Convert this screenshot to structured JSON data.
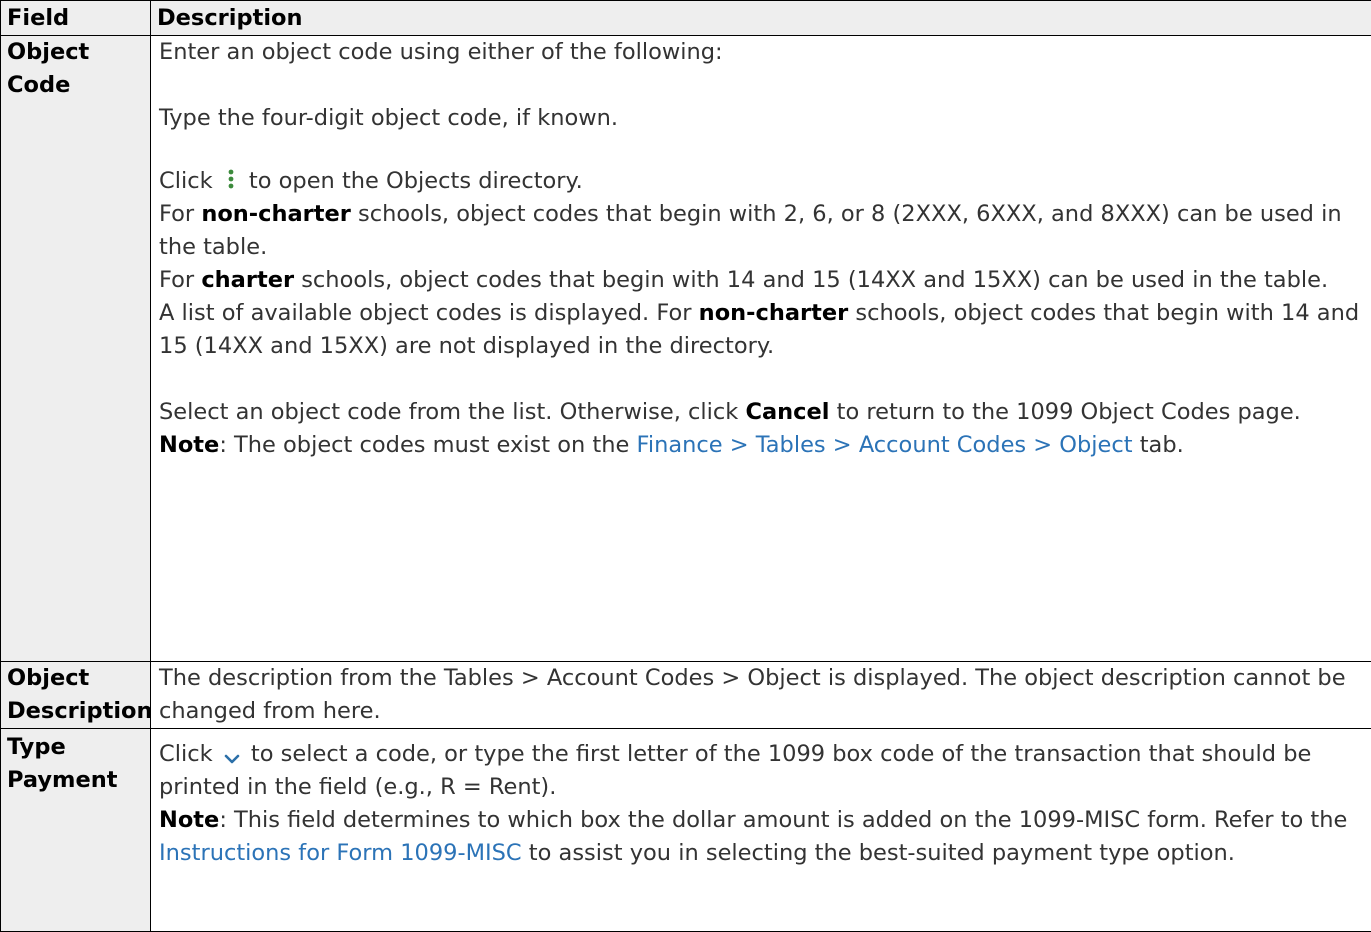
{
  "header": {
    "field": "Field",
    "description": "Description"
  },
  "icons": {
    "directory_icon": "vertical-ellipsis-icon",
    "dropdown_icon": "chevron-down-icon",
    "dots_color": "#3c8a3c",
    "chevron_color": "#2b6fa8",
    "link_color": "#2b73b7"
  },
  "rows": {
    "object_code": {
      "name": "Object Code",
      "p1": "Enter an object code using either of the following:",
      "p2": "Type the four-digit object code, if known.",
      "p3a": "Click ",
      "p3b": " to open the Objects directory.",
      "p4a": "For ",
      "p4b": "non-charter",
      "p4c": " schools, object codes that begin with 2, 6, or 8 (2XXX, 6XXX, and 8XXX) can be used in the table.",
      "p5a": "For ",
      "p5b": "charter",
      "p5c": " schools, object codes that begin with 14 and 15 (14XX and 15XX) can be used in the table.",
      "p6a": "A list of available object codes is displayed. For ",
      "p6b": "non-charter",
      "p6c": " schools, object codes that begin with 14 and 15 (14XX and 15XX) are not displayed in the directory.",
      "p7a": "Select an object code from the list. Otherwise, click ",
      "p7b": "Cancel",
      "p7c": " to return to the 1099 Object Codes page.",
      "note_label": "Note",
      "note_text": ": The object codes must exist on the ",
      "note_link": "Finance > Tables > Account Codes > Object",
      "note_end": " tab."
    },
    "object_description": {
      "name": "Object Description",
      "text": "The description from the Tables > Account Codes > Object is displayed. The object description cannot be changed from here."
    },
    "type_payment": {
      "name": "Type Payment",
      "p1a": "Click ",
      "p1b": " to select a code, or type the first letter of the 1099 box code of the transaction that should be printed in the field (e.g., R = Rent).",
      "note_label": "Note",
      "note_text": ": This field determines to which box the dollar amount is added on the 1099-MISC form. Refer to the ",
      "note_link": "Instructions for Form 1099-MISC",
      "note_end": " to assist you in selecting the best-suited payment type option."
    }
  }
}
